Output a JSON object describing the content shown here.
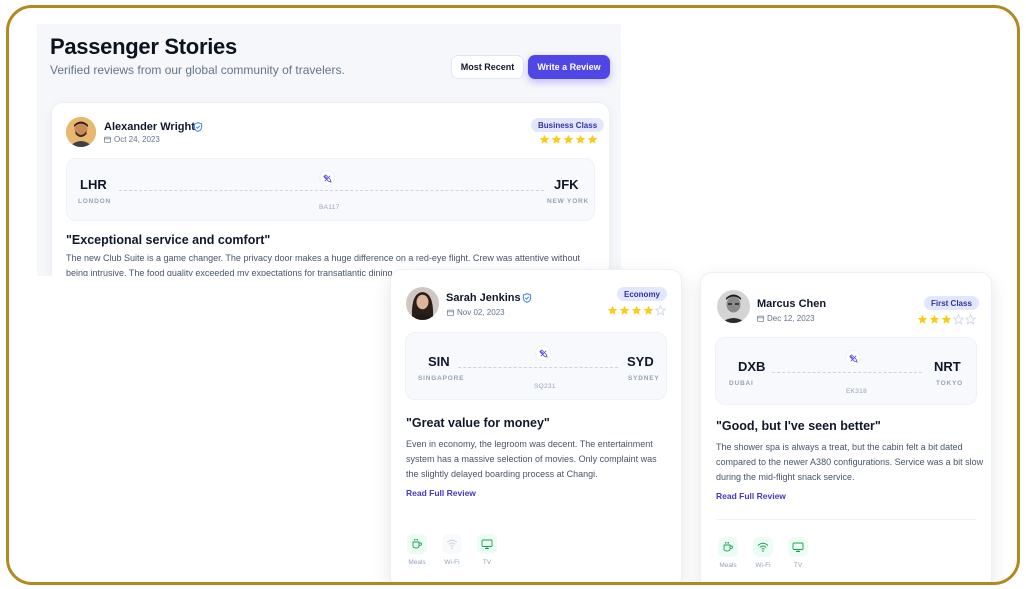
{
  "header": {
    "title": "Passenger Stories",
    "subtitle": "Verified reviews from our global community of travelers.",
    "sort_label": "Most Recent",
    "write_label": "Write a Review"
  },
  "colors": {
    "accent": "#4f46e5",
    "star": "#facc15",
    "amenity": "#16a34a",
    "frame": "#b08a1f"
  },
  "reviews": [
    {
      "name": "Alexander Wright",
      "verified": true,
      "date": "Oct 24, 2023",
      "cabin_class": "Business Class",
      "rating": 5,
      "from_code": "LHR",
      "from_city": "LONDON",
      "to_code": "JFK",
      "to_city": "NEW YORK",
      "flight": "BA117",
      "title": "\"Exceptional service and comfort\"",
      "body": "The new Club Suite is a game changer. The privacy door makes a huge difference on a red-eye flight. Crew was attentive without being intrusive. The food quality exceeded my expectations for transatlantic dining."
    },
    {
      "name": "Sarah Jenkins",
      "verified": true,
      "date": "Nov 02, 2023",
      "cabin_class": "Economy",
      "rating": 4,
      "from_code": "SIN",
      "from_city": "SINGAPORE",
      "to_code": "SYD",
      "to_city": "SYDNEY",
      "flight": "SQ231",
      "title": "\"Great value for money\"",
      "body": "Even in economy, the legroom was decent. The entertainment system has a massive selection of movies. Only complaint was the slightly delayed boarding process at Changi.",
      "read_more": "Read Full Review",
      "amenities": [
        {
          "label": "Meals",
          "icon": "cup-icon",
          "available": true
        },
        {
          "label": "Wi-Fi",
          "icon": "wifi-icon",
          "available": false
        },
        {
          "label": "TV",
          "icon": "monitor-icon",
          "available": true
        }
      ]
    },
    {
      "name": "Marcus Chen",
      "verified": false,
      "date": "Dec 12, 2023",
      "cabin_class": "First Class",
      "rating": 3,
      "from_code": "DXB",
      "from_city": "DUBAI",
      "to_code": "NRT",
      "to_city": "TOKYO",
      "flight": "EK318",
      "title": "\"Good, but I've seen better\"",
      "body": "The shower spa is always a treat, but the cabin felt a bit dated compared to the newer A380 configurations. Service was a bit slow during the mid-flight snack service.",
      "read_more": "Read Full Review",
      "amenities": [
        {
          "label": "Meals",
          "icon": "cup-icon",
          "available": true
        },
        {
          "label": "Wi-Fi",
          "icon": "wifi-icon",
          "available": true
        },
        {
          "label": "TV",
          "icon": "monitor-icon",
          "available": true
        }
      ]
    }
  ]
}
